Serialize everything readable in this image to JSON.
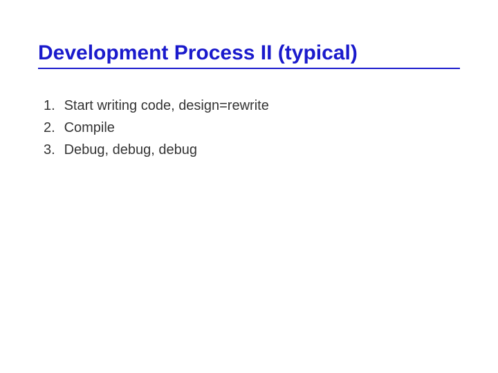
{
  "title": "Development Process II (typical)",
  "items": [
    {
      "num": "1.",
      "text": "Start writing code, design=rewrite"
    },
    {
      "num": "2.",
      "text": "Compile"
    },
    {
      "num": "3.",
      "text": "Debug, debug, debug"
    }
  ]
}
